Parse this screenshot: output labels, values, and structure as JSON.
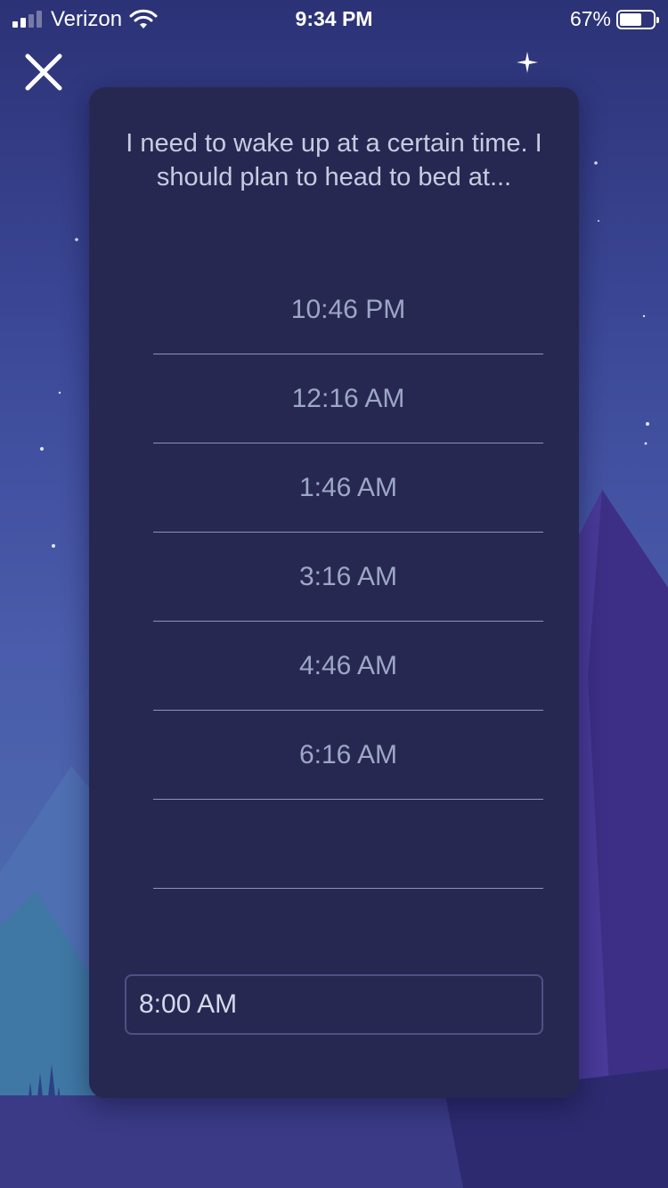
{
  "status_bar": {
    "carrier": "Verizon",
    "time": "9:34 PM",
    "battery_percent": "67%",
    "battery_level": 0.67,
    "signal_bars_active": 2,
    "signal_bars_total": 4,
    "icons": [
      "signal-icon",
      "wifi-icon",
      "battery-icon"
    ]
  },
  "header": {
    "close_icon": "close-icon"
  },
  "card": {
    "prompt": "I need to wake up at a certain time. I should plan to head to bed at...",
    "bed_times": [
      "10:46 PM",
      "12:16 AM",
      "1:46 AM",
      "3:16 AM",
      "4:46 AM",
      "6:16 AM",
      ""
    ],
    "wake_time_value": "8:00 AM"
  },
  "colors": {
    "card_background": "#272852",
    "sky_top": "#2c3276",
    "sky_bottom": "#4c68ad",
    "time_text": "#9ca7c6",
    "divider": "#8f93b2"
  }
}
